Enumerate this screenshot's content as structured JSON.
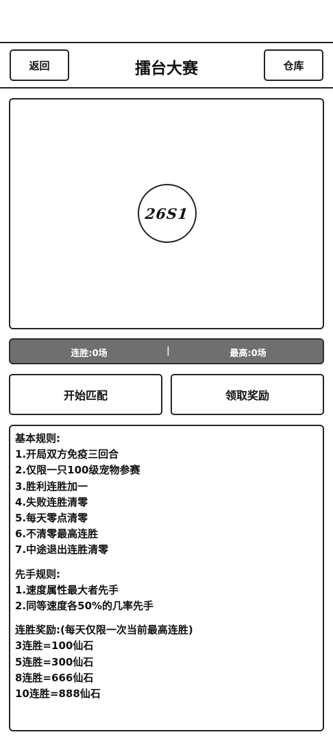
{
  "header": {
    "back_label": "返回",
    "title": "擂台大赛",
    "warehouse_label": "仓库"
  },
  "arena": {
    "code": "26S1"
  },
  "streak": {
    "current": "连胜:0场",
    "separator": "|",
    "best": "最高:0场"
  },
  "actions": {
    "match_label": "开始匹配",
    "claim_label": "领取奖励"
  },
  "rules": {
    "basic_title": "基本规则:",
    "basic": [
      "1.开局双方免疫三回合",
      "2.仅限一只100级宠物参赛",
      "3.胜利连胜加一",
      "4.失败连胜清零",
      "5.每天零点清零",
      "6.不清零最高连胜",
      "7.中途退出连胜清零"
    ],
    "first_title": "先手规则:",
    "first": [
      "1.速度属性最大者先手",
      "2.同等速度各50%的几率先手"
    ],
    "reward_title": "连胜奖励:(每天仅限一次当前最高连胜)",
    "rewards": [
      "3连胜=100仙石",
      "5连胜=300仙石",
      "8连胜=666仙石",
      "10连胜=888仙石"
    ]
  }
}
